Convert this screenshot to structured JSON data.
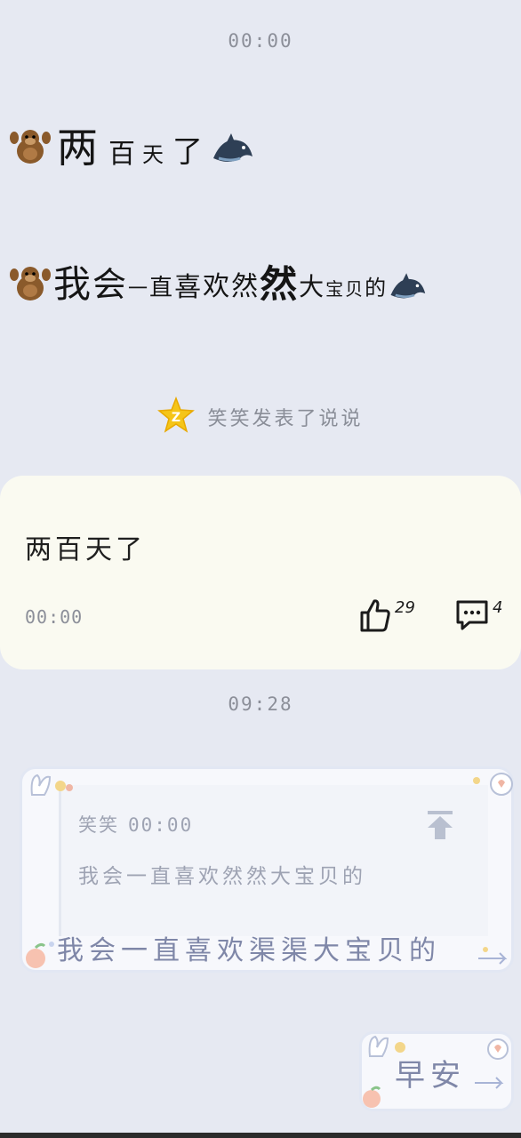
{
  "chat": {
    "timestamp_1": "00:00",
    "message_1": {
      "parts": [
        "两",
        "百",
        "天",
        "了"
      ]
    },
    "message_2": {
      "parts": [
        "我",
        "会",
        "一",
        "直",
        "喜",
        "欢",
        "然",
        "然",
        "大",
        "宝",
        "贝",
        "的"
      ]
    },
    "system_notice": {
      "icon": "qzone-star-icon",
      "text": "笑笑发表了说说"
    },
    "post": {
      "text": "两百天了",
      "time": "00:00",
      "likes": "29",
      "comments": "4"
    },
    "timestamp_2": "09:28",
    "quote": {
      "sender": "笑笑",
      "time": "00:00",
      "quoted_text": "我会一直喜欢然然大宝贝的",
      "reply": "我会一直喜欢渠渠大宝贝的"
    },
    "last_message": "早安"
  },
  "colors": {
    "background": "#e6e9f2",
    "card": "#fafaf1",
    "timestamp": "#8c8f99",
    "bubble_text": "#7f87a8"
  }
}
